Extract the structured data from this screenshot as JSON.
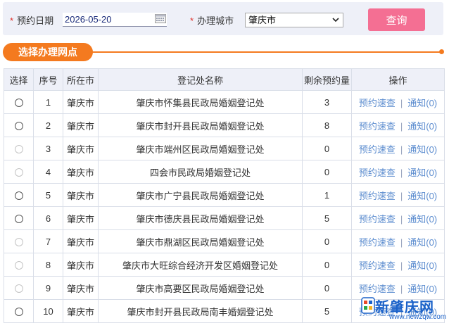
{
  "filter": {
    "required_mark": "*",
    "date_label": "预约日期",
    "date_value": "2026-05-20",
    "city_label": "办理城市",
    "city_selected": "肇庆市",
    "query_button": "查询"
  },
  "section": {
    "title": "选择办理网点"
  },
  "table": {
    "headers": [
      "选择",
      "序号",
      "所在市",
      "登记处名称",
      "剩余预约量",
      "操作"
    ],
    "rows": [
      {
        "index": "1",
        "city": "肇庆市",
        "name": "肇庆市怀集县民政局婚姻登记处",
        "remaining": "3",
        "enabled": true
      },
      {
        "index": "2",
        "city": "肇庆市",
        "name": "肇庆市封开县民政局婚姻登记处",
        "remaining": "8",
        "enabled": true
      },
      {
        "index": "3",
        "city": "肇庆市",
        "name": "肇庆市端州区民政局婚姻登记处",
        "remaining": "0",
        "enabled": false
      },
      {
        "index": "4",
        "city": "肇庆市",
        "name": "四会市民政局婚姻登记处",
        "remaining": "0",
        "enabled": false
      },
      {
        "index": "5",
        "city": "肇庆市",
        "name": "肇庆市广宁县民政局婚姻登记处",
        "remaining": "1",
        "enabled": true
      },
      {
        "index": "6",
        "city": "肇庆市",
        "name": "肇庆市德庆县民政局婚姻登记处",
        "remaining": "5",
        "enabled": true
      },
      {
        "index": "7",
        "city": "肇庆市",
        "name": "肇庆市鼎湖区民政局婚姻登记处",
        "remaining": "0",
        "enabled": false
      },
      {
        "index": "8",
        "city": "肇庆市",
        "name": "肇庆市大旺综合经济开发区婚姻登记处",
        "remaining": "0",
        "enabled": false
      },
      {
        "index": "9",
        "city": "肇庆市",
        "name": "肇庆市高要区民政局婚姻登记处",
        "remaining": "0",
        "enabled": false
      },
      {
        "index": "10",
        "city": "肇庆市",
        "name": "肇庆市封开县民政局南丰婚姻登记处",
        "remaining": "5",
        "enabled": true
      }
    ],
    "op_query": "预约速查",
    "op_notify": "通知(0)",
    "op_separator": "|"
  },
  "colors": {
    "accent_orange": "#f47a1f",
    "query_button_pink": "#f46f93",
    "available_green": "#1a8a1a",
    "unavailable_red": "#d9261c",
    "link_blue": "#5b8ccf"
  },
  "watermark": {
    "title": "新肇庆网",
    "url": "www.newzqw.com"
  }
}
